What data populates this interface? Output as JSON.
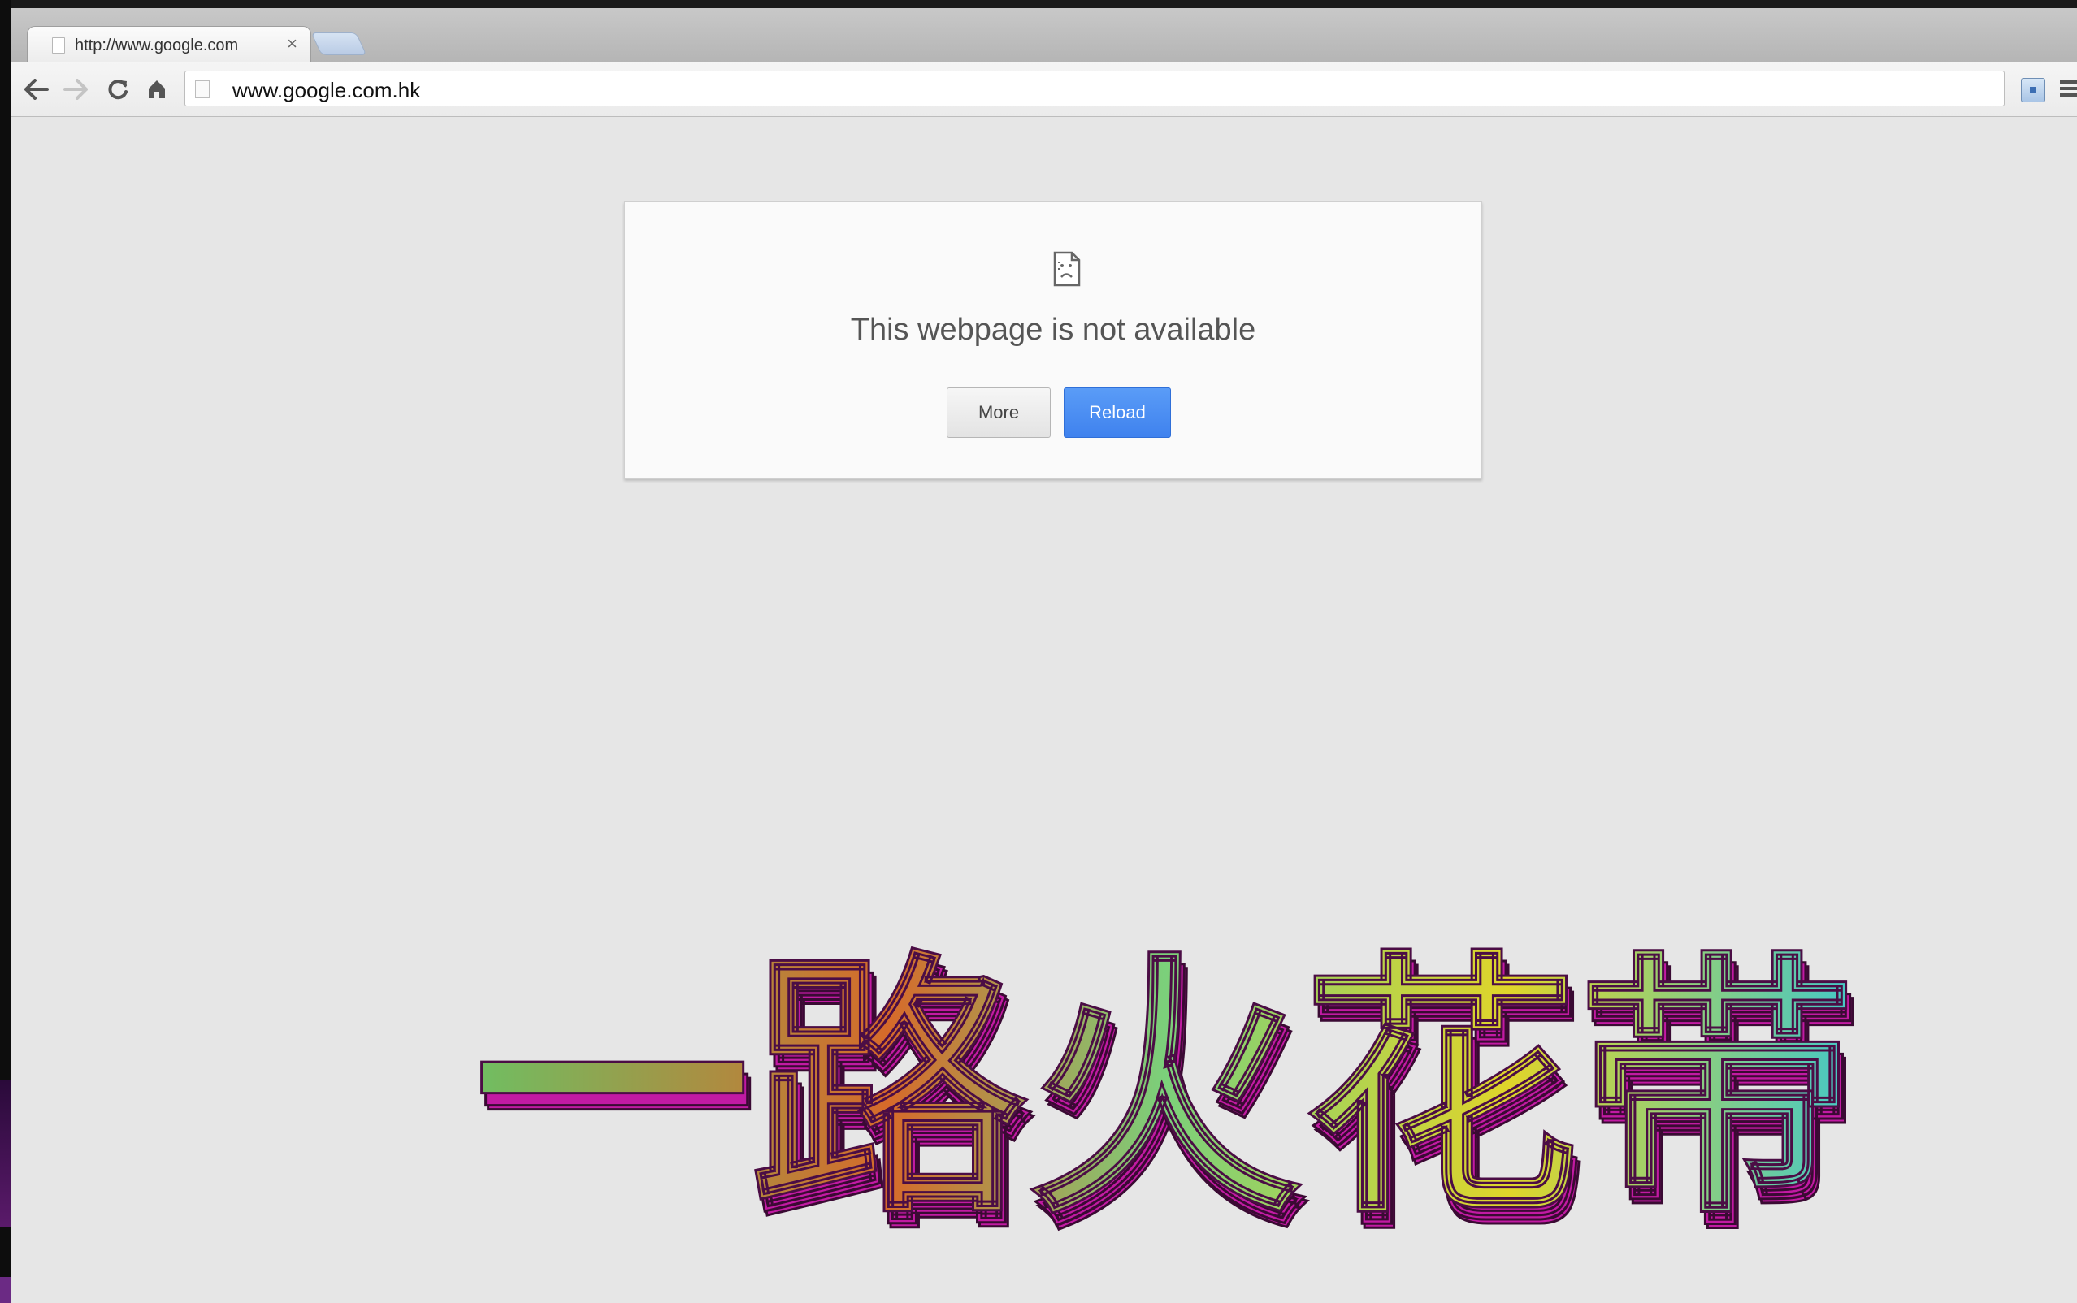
{
  "browser": {
    "tab": {
      "title": "http://www.google.com",
      "close_glyph": "×"
    },
    "toolbar": {
      "url": "www.google.com.hk",
      "back_icon": "arrow-left-icon",
      "forward_icon": "arrow-right-icon",
      "reload_icon": "reload-icon",
      "home_icon": "home-icon",
      "menu_icon": "hamburger-menu-icon"
    }
  },
  "error_page": {
    "icon": "broken-page-icon",
    "title": "This webpage is not available",
    "buttons": {
      "more": "More",
      "reload": "Reload"
    },
    "reload_color": "#4a8df4"
  },
  "overlay": {
    "text": "一路火花带",
    "colors": {
      "extrude": "#c21aa3",
      "face_start": "#6fbf62",
      "face_mid": "#e0d52a",
      "face_end": "#43c8c8"
    }
  }
}
